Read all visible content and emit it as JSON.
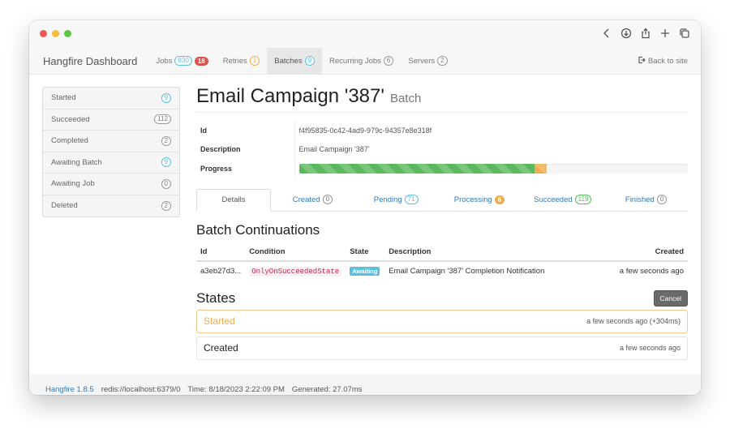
{
  "window": {
    "traffic_lights": [
      "close",
      "minimize",
      "maximize"
    ],
    "browser_tools": [
      "back-icon",
      "download-icon",
      "share-icon",
      "new-tab-icon",
      "tabs-icon"
    ]
  },
  "navbar": {
    "brand": "Hangfire Dashboard",
    "items": [
      {
        "label": "Jobs",
        "badge": "830",
        "badge_style": "info",
        "badge2": "18",
        "badge2_style": "danger"
      },
      {
        "label": "Retries",
        "badge": "1",
        "badge_style": "warn"
      },
      {
        "label": "Batches",
        "badge": "9",
        "badge_style": "info",
        "active": true
      },
      {
        "label": "Recurring Jobs",
        "badge": "6",
        "badge_style": "default"
      },
      {
        "label": "Servers",
        "badge": "2",
        "badge_style": "default"
      }
    ],
    "back_to_site": "Back to site"
  },
  "sidebar": {
    "items": [
      {
        "label": "Started",
        "count": "9",
        "style": "info"
      },
      {
        "label": "Succeeded",
        "count": "112",
        "style": "default"
      },
      {
        "label": "Completed",
        "count": "2",
        "style": "default"
      },
      {
        "label": "Awaiting Batch",
        "count": "9",
        "style": "info"
      },
      {
        "label": "Awaiting Job",
        "count": "0",
        "style": "default"
      },
      {
        "label": "Deleted",
        "count": "2",
        "style": "default"
      }
    ]
  },
  "page": {
    "title": "Email Campaign '387'",
    "subtitle": "Batch",
    "details": {
      "id_label": "Id",
      "id_value": "f4f95835-0c42-4ad9-979c-94357e8e318f",
      "description_label": "Description",
      "description_value": "Email Campaign '387'",
      "progress_label": "Progress",
      "progress": {
        "succeeded_pct": 60.5,
        "processing_pct": 3.2
      }
    },
    "tabs": [
      {
        "label": "Details",
        "active": true
      },
      {
        "label": "Created",
        "badge": "0",
        "badge_style": "default"
      },
      {
        "label": "Pending",
        "badge": "71",
        "badge_style": "info"
      },
      {
        "label": "Processing",
        "badge": "6",
        "badge_style": "warn-filled"
      },
      {
        "label": "Succeeded",
        "badge": "119",
        "badge_style": "success"
      },
      {
        "label": "Finished",
        "badge": "0",
        "badge_style": "default"
      }
    ],
    "continuations": {
      "heading": "Batch Continuations",
      "columns": [
        "Id",
        "Condition",
        "State",
        "Description",
        "Created"
      ],
      "rows": [
        {
          "id": "a3eb27d3...",
          "condition": "OnlyOnSucceededState",
          "state": "Awaiting",
          "description": "Email Campaign '387' Completion Notification",
          "created": "a few seconds ago"
        }
      ]
    },
    "states": {
      "heading": "States",
      "cancel_label": "Cancel",
      "items": [
        {
          "name": "Started",
          "time": "a few seconds ago (+304ms)",
          "current": true
        },
        {
          "name": "Created",
          "time": "a few seconds ago",
          "current": false
        }
      ]
    }
  },
  "footer": {
    "version": "Hangfire 1.8.5",
    "storage": "redis://localhost:6379/0",
    "time": "Time: 8/18/2023 2:22:09 PM",
    "generated": "Generated: 27.07ms"
  },
  "colors": {
    "success": "#5cb85c",
    "warning": "#f0ad4e",
    "info": "#5bc0de",
    "danger": "#d9534f",
    "link": "#337ab7"
  }
}
